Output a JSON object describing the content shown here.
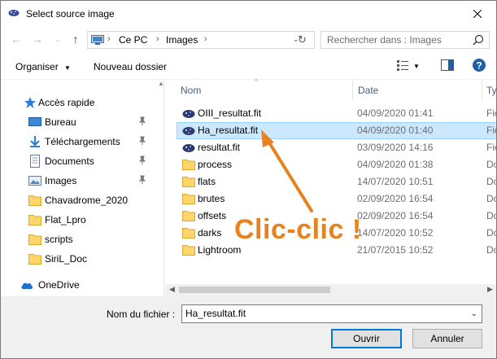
{
  "window": {
    "title": "Select source image"
  },
  "address": {
    "crumbs": [
      "Ce PC",
      "Images"
    ]
  },
  "search": {
    "placeholder": "Rechercher dans : Images"
  },
  "toolbar": {
    "organize_label": "Organiser",
    "new_folder_label": "Nouveau dossier"
  },
  "sidebar": {
    "items": [
      {
        "label": "Accès rapide",
        "icon": "star-icon",
        "pinned": false
      },
      {
        "label": "Bureau",
        "icon": "desktop-icon",
        "pinned": true
      },
      {
        "label": "Téléchargements",
        "icon": "download-icon",
        "pinned": true
      },
      {
        "label": "Documents",
        "icon": "documents-icon",
        "pinned": true
      },
      {
        "label": "Images",
        "icon": "pictures-icon",
        "pinned": true
      },
      {
        "label": "Chavadrome_2020",
        "icon": "folder-icon",
        "pinned": false
      },
      {
        "label": "Flat_Lpro",
        "icon": "folder-icon",
        "pinned": false
      },
      {
        "label": "scripts",
        "icon": "folder-icon",
        "pinned": false
      },
      {
        "label": "SiriL_Doc",
        "icon": "folder-icon",
        "pinned": false
      },
      {
        "label": "OneDrive",
        "icon": "cloud-icon",
        "pinned": false
      }
    ]
  },
  "columns": {
    "name": "Nom",
    "date": "Date",
    "type": "Ty"
  },
  "files": [
    {
      "name": "OIII_resultat.fit",
      "date": "04/09/2020 01:41",
      "type": "Fic",
      "icon": "fits-file-icon"
    },
    {
      "name": "Ha_resultat.fit",
      "date": "04/09/2020 01:40",
      "type": "Fic",
      "icon": "fits-file-icon",
      "selected": true
    },
    {
      "name": "resultat.fit",
      "date": "03/09/2020 14:16",
      "type": "Fic",
      "icon": "fits-file-icon"
    },
    {
      "name": "process",
      "date": "04/09/2020 01:38",
      "type": "Do",
      "icon": "folder-icon"
    },
    {
      "name": "flats",
      "date": "14/07/2020 10:51",
      "type": "Do",
      "icon": "folder-icon"
    },
    {
      "name": "brutes",
      "date": "02/09/2020 16:54",
      "type": "Do",
      "icon": "folder-icon"
    },
    {
      "name": "offsets",
      "date": "02/09/2020 16:54",
      "type": "Do",
      "icon": "folder-icon"
    },
    {
      "name": "darks",
      "date": "14/07/2020 10:52",
      "type": "Do",
      "icon": "folder-icon"
    },
    {
      "name": "Lightroom",
      "date": "21/07/2015 10:52",
      "type": "Do",
      "icon": "folder-icon"
    }
  ],
  "annotation": {
    "text": "Clic-clic !",
    "color": "#e8821e"
  },
  "footer": {
    "filename_label": "Nom du fichier :",
    "filename_value": "Ha_resultat.fit",
    "open_label": "Ouvrir",
    "cancel_label": "Annuler"
  },
  "colors": {
    "accent": "#0078d7",
    "selection": "#cce8ff",
    "folder": "#ffd66b"
  }
}
